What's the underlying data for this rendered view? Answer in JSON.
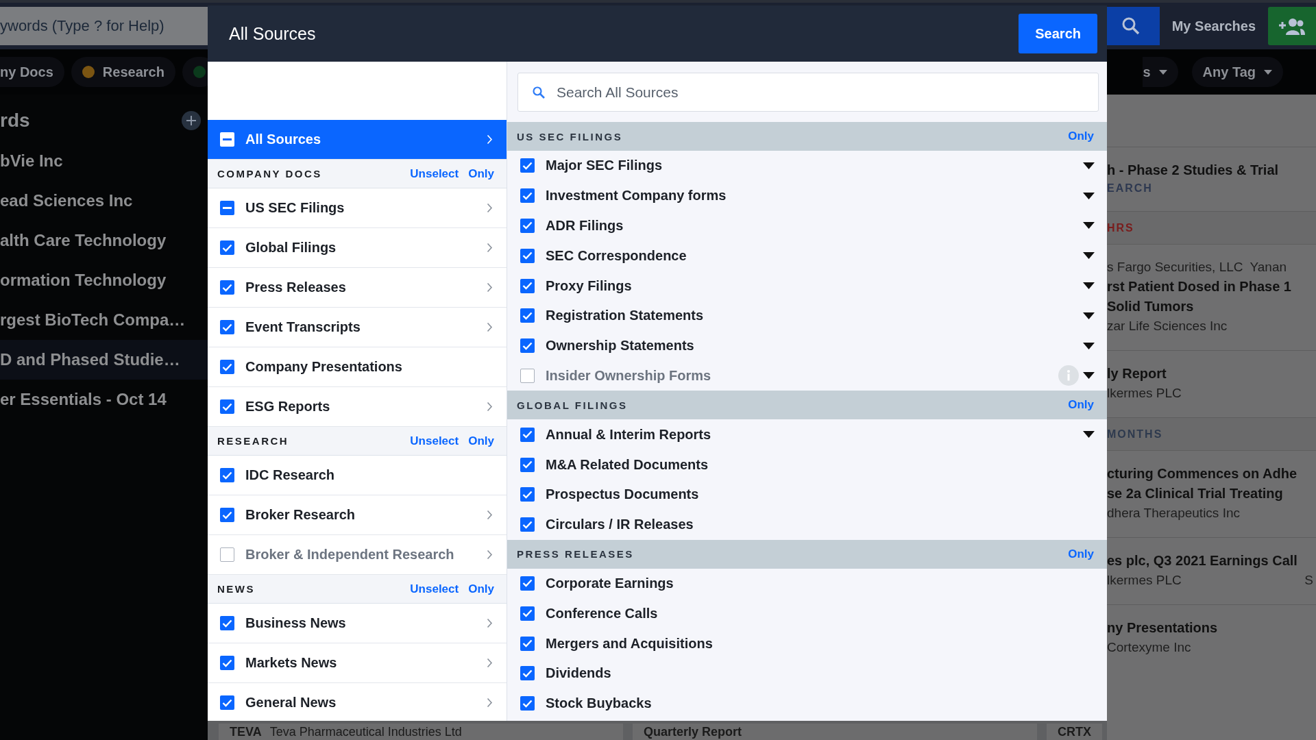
{
  "topbar": {
    "search": {
      "placeholder": "ywords (Type ? for Help)"
    },
    "my_searches": "My Searches"
  },
  "filters": {
    "chips": [
      {
        "label": "ny Docs"
      },
      {
        "label": "Research",
        "color": "#7b5512"
      },
      {
        "color": "#0b3a1c"
      }
    ],
    "dropdowns": [
      {
        "label": "s"
      },
      {
        "label": "Any Tag"
      }
    ]
  },
  "sidebar": {
    "heading": "rds",
    "items": [
      {
        "label": "bVie Inc",
        "selected": false
      },
      {
        "label": "ead Sciences Inc",
        "selected": false
      },
      {
        "label": "alth Care Technology",
        "selected": false
      },
      {
        "label": "ormation Technology",
        "selected": false
      },
      {
        "label": "rgest BioTech Compa…",
        "selected": false
      },
      {
        "label": "D and Phased Studie…",
        "selected": true
      },
      {
        "label": "er Essentials - Oct 14",
        "selected": false
      }
    ]
  },
  "results": [
    {
      "kind": "card",
      "lines": [
        {
          "kind": "title",
          "text": "h - Phase 2 Studies & Trial"
        },
        {
          "kind": "tag",
          "text": "EARCH"
        }
      ]
    },
    {
      "kind": "band",
      "label": "HRS",
      "color": "#7a1c1c"
    },
    {
      "kind": "card",
      "lines": [
        {
          "kind": "meta",
          "text": "s Fargo Securities, LLC",
          "extra": "Yanan"
        },
        {
          "kind": "title",
          "text": "rst Patient Dosed in Phase 1"
        },
        {
          "kind": "title",
          "text": "Solid Tumors"
        },
        {
          "kind": "meta",
          "text": "zar Life Sciences Inc"
        }
      ]
    },
    {
      "kind": "card",
      "lines": [
        {
          "kind": "title",
          "text": "ly Report"
        },
        {
          "kind": "meta",
          "text": "lkermes PLC"
        }
      ]
    },
    {
      "kind": "band",
      "label": "MONTHS",
      "color": "#2e3a4e"
    },
    {
      "kind": "card",
      "lines": [
        {
          "kind": "title",
          "text": "cturing Commences on Adhe"
        },
        {
          "kind": "title",
          "text": "se 2a Clinical Trial Treating"
        },
        {
          "kind": "meta",
          "text": "dhera Therapeutics Inc"
        }
      ]
    },
    {
      "kind": "card",
      "lines": [
        {
          "kind": "title",
          "text": "es plc, Q3 2021 Earnings Call"
        },
        {
          "kind": "meta",
          "text": "lkermes PLC",
          "aside": "S"
        }
      ]
    },
    {
      "kind": "card",
      "lines": [
        {
          "kind": "title",
          "text": "ny Presentations"
        },
        {
          "kind": "meta",
          "text": "Cortexyme Inc"
        }
      ]
    }
  ],
  "bottom": [
    {
      "ticker": "TEVA",
      "name": "Teva Pharmaceutical Industries Ltd"
    },
    {
      "title": "Quarterly Report"
    },
    {
      "ticker": "CRTX"
    }
  ],
  "modal": {
    "title": "All Sources",
    "search_button": "Search",
    "all_row": {
      "label": "All Sources",
      "checked": false,
      "partial": true,
      "selected": true
    },
    "groups": [
      {
        "heading": "COMPANY DOCS",
        "unselect": "Unselect",
        "only": "Only",
        "items": [
          {
            "label": "US SEC Filings",
            "checked": false,
            "partial": true,
            "expandable": true
          },
          {
            "label": "Global Filings",
            "checked": true,
            "partial": false,
            "expandable": true
          },
          {
            "label": "Press Releases",
            "checked": true,
            "partial": false,
            "expandable": true
          },
          {
            "label": "Event Transcripts",
            "checked": true,
            "partial": false,
            "expandable": true
          },
          {
            "label": "Company Presentations",
            "checked": true,
            "partial": false,
            "expandable": false
          },
          {
            "label": "ESG Reports",
            "checked": true,
            "partial": false,
            "expandable": true
          }
        ]
      },
      {
        "heading": "RESEARCH",
        "unselect": "Unselect",
        "only": "Only",
        "items": [
          {
            "label": "IDC Research",
            "checked": true,
            "partial": false,
            "expandable": false
          },
          {
            "label": "Broker Research",
            "checked": true,
            "partial": false,
            "expandable": true
          },
          {
            "label": "Broker & Independent Research",
            "checked": false,
            "partial": false,
            "expandable": true
          }
        ]
      },
      {
        "heading": "NEWS",
        "unselect": "Unselect",
        "only": "Only",
        "items": [
          {
            "label": "Business News",
            "checked": true,
            "partial": false,
            "expandable": true
          },
          {
            "label": "Markets News",
            "checked": true,
            "partial": false,
            "expandable": true
          },
          {
            "label": "General News",
            "checked": true,
            "partial": false,
            "expandable": true
          }
        ]
      }
    ],
    "search": {
      "placeholder": "Search All Sources"
    },
    "sections": [
      {
        "heading": "US SEC FILINGS",
        "only": "Only",
        "items": [
          {
            "label": "Major SEC Filings",
            "checked": true,
            "expandable": true,
            "info": false
          },
          {
            "label": "Investment Company forms",
            "checked": true,
            "expandable": true,
            "info": false
          },
          {
            "label": "ADR Filings",
            "checked": true,
            "expandable": true,
            "info": false
          },
          {
            "label": "SEC Correspondence",
            "checked": true,
            "expandable": true,
            "info": false
          },
          {
            "label": "Proxy Filings",
            "checked": true,
            "expandable": true,
            "info": false
          },
          {
            "label": "Registration Statements",
            "checked": true,
            "expandable": true,
            "info": false
          },
          {
            "label": "Ownership Statements",
            "checked": true,
            "expandable": true,
            "info": false
          },
          {
            "label": "Insider Ownership Forms",
            "checked": false,
            "expandable": true,
            "info": true
          }
        ]
      },
      {
        "heading": "GLOBAL FILINGS",
        "only": "Only",
        "items": [
          {
            "label": "Annual & Interim Reports",
            "checked": true,
            "expandable": true,
            "info": false
          },
          {
            "label": "M&A Related Documents",
            "checked": true,
            "expandable": false,
            "info": false
          },
          {
            "label": "Prospectus Documents",
            "checked": true,
            "expandable": false,
            "info": false
          },
          {
            "label": "Circulars / IR Releases",
            "checked": true,
            "expandable": false,
            "info": false
          }
        ]
      },
      {
        "heading": "PRESS RELEASES",
        "only": "Only",
        "items": [
          {
            "label": "Corporate Earnings",
            "checked": true,
            "expandable": false,
            "info": false
          },
          {
            "label": "Conference Calls",
            "checked": true,
            "expandable": false,
            "info": false
          },
          {
            "label": "Mergers and Acquisitions",
            "checked": true,
            "expandable": false,
            "info": false
          },
          {
            "label": "Dividends",
            "checked": true,
            "expandable": false,
            "info": false
          },
          {
            "label": "Stock Buybacks",
            "checked": true,
            "expandable": false,
            "info": false
          }
        ]
      }
    ]
  }
}
